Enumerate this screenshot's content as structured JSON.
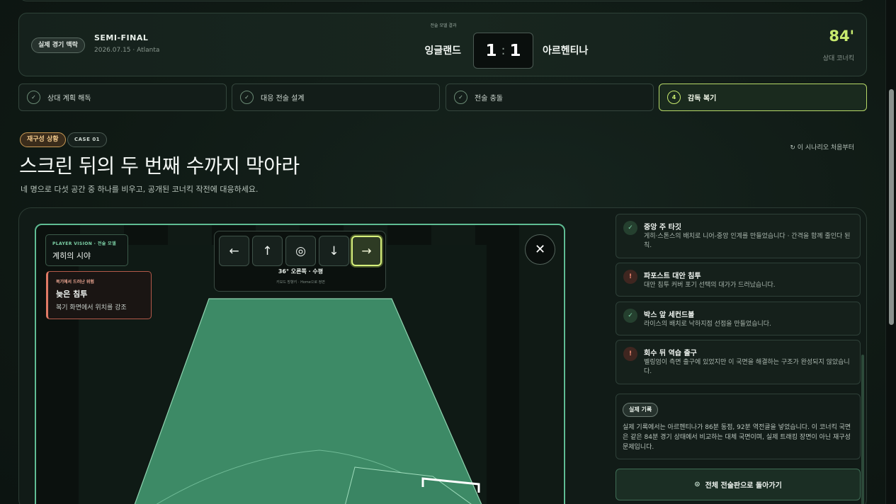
{
  "header": {
    "context_label": "실제 경기 맥락",
    "stage": "SEMI-FINAL",
    "meta": "2026.07.15 · Atlanta",
    "result_caption": "전술 모델 결과",
    "home_team": "잉글랜드",
    "home_score": "1",
    "score_sep": ":",
    "away_score": "1",
    "away_team": "아르헨티나",
    "minute": "84'",
    "minute_caption": "상대 코너킥"
  },
  "steps": [
    {
      "label": "상대 계획 해독",
      "icon": "✓",
      "state": "done"
    },
    {
      "label": "대응 전술 설계",
      "icon": "✓",
      "state": "done"
    },
    {
      "label": "전술 충돌",
      "icon": "✓",
      "state": "done"
    },
    {
      "label": "감독 복기",
      "icon": "4",
      "state": "active"
    }
  ],
  "scenario": {
    "tag": "재구성 상황",
    "case": "CASE 01",
    "restart": "↻ 이 시나리오 처음부터",
    "title": "스크린 뒤의 두 번째 수까지 막아라",
    "subtitle": "네 명으로 다섯 공간 중 하나를 비우고, 공개된 코너킥 작전에 대응하세요."
  },
  "board": {
    "vision_kicker": "PLAYER VISION · 전술 모델",
    "vision_title": "계히의 시야",
    "risk_kicker": "복기에서 드러난 위험",
    "risk_title": "늦은 침투",
    "risk_desc": "복기 화면에서 위치를 강조",
    "directions": [
      {
        "glyph": "←",
        "name": "left"
      },
      {
        "glyph": "↑",
        "name": "up"
      },
      {
        "glyph": "◎",
        "name": "center"
      },
      {
        "glyph": "↓",
        "name": "down"
      },
      {
        "glyph": "→",
        "name": "right"
      }
    ],
    "active_direction": "right",
    "readout": "36° 오른쪽 · 수평",
    "hint": "키보드 방향키 · Home으로 정면",
    "close_glyph": "✕"
  },
  "insights": [
    {
      "state": "ok",
      "icon": "✓",
      "title": "중앙 주 타깃",
      "desc": "게히·스톤스의 배치로 니어-중앙 인계를 만들었습니다 · 간격을 함께 줄인다 된칙."
    },
    {
      "state": "warn",
      "icon": "!",
      "title": "파포스트 대안 침투",
      "desc": "대안 침투 커버 포기 선택의 대가가 드러났습니다."
    },
    {
      "state": "ok",
      "icon": "✓",
      "title": "박스 앞 세컨드볼",
      "desc": "라이스의 배치로 낙하지점 선점을 만들었습니다."
    },
    {
      "state": "warn",
      "icon": "!",
      "title": "회수 뒤 역습 출구",
      "desc": "벨링엄이 측면 출구에 있었지만 이 국면을 해결하는 구조가 완성되지 않았습니다."
    }
  ],
  "record": {
    "label": "실제 기록",
    "text": "실제 기록에서는 아르헨티나가 86분 동점, 92분 역전골을 넣었습니다. 이 코너킥 국면은 같은 84분 경기 상태에서 비교하는 대체 국면이며, 실제 트래킹 장면이 아닌 재구성 문제입니다."
  },
  "back_button": {
    "icon": "⊙",
    "label": "전체 전술판으로 돌아가기"
  },
  "colors": {
    "accent": "#c8ea6e",
    "pitch": "#3d8a66",
    "warn": "#f08a74",
    "ok": "#7fd3a8"
  }
}
